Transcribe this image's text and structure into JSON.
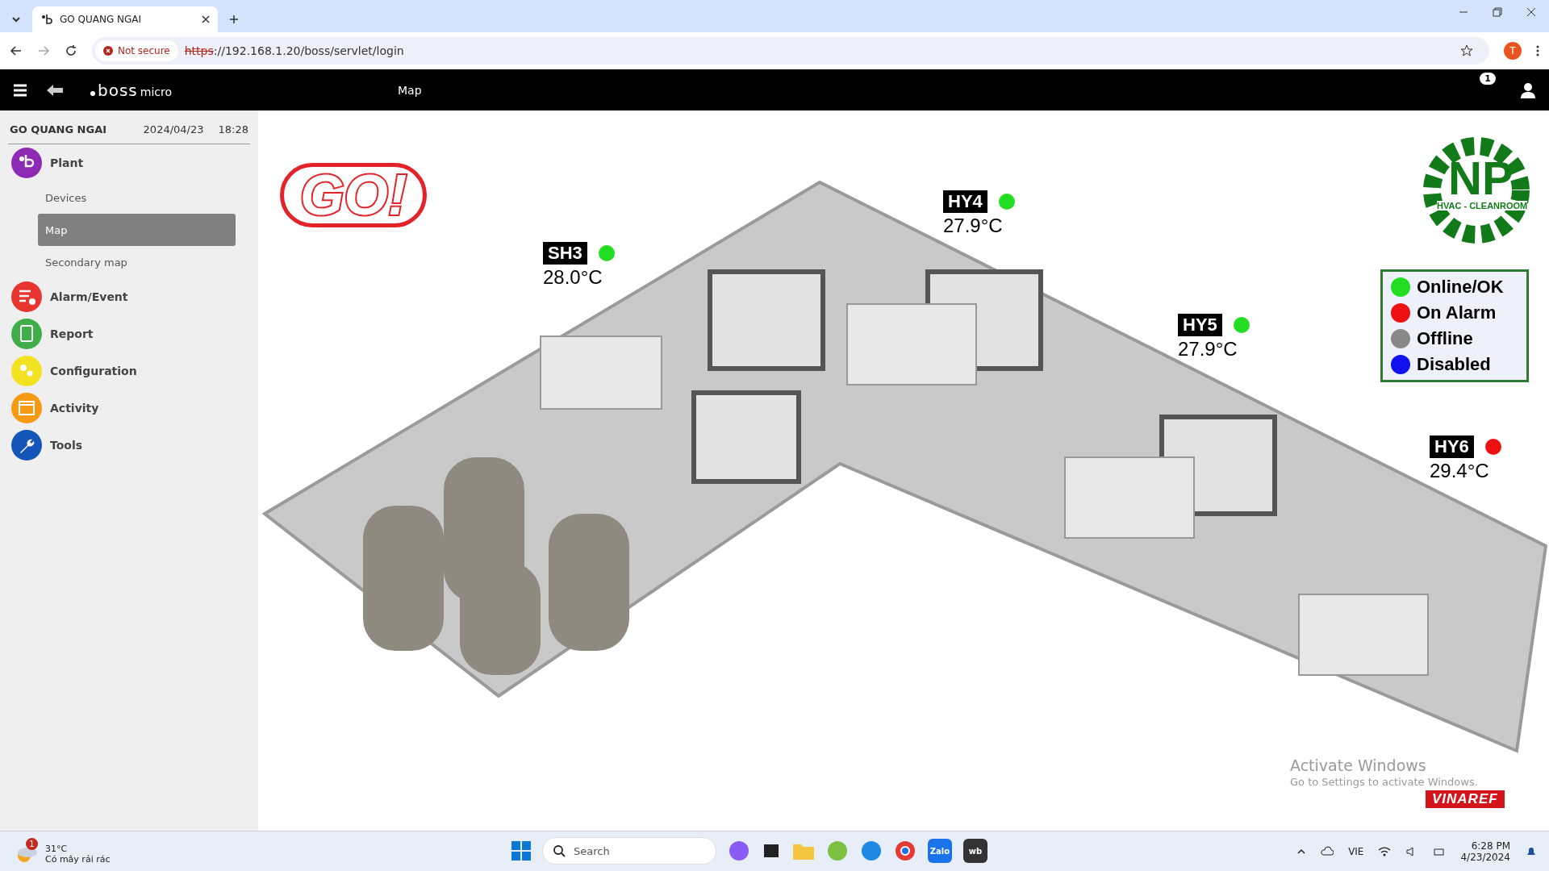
{
  "browser": {
    "tab_title": "GO QUANG NGAI",
    "security": "Not secure",
    "url_scheme": "https",
    "url_rest": "://192.168.1.20/boss/servlet/login",
    "profile": "T"
  },
  "header": {
    "brand": "boss",
    "brand_suffix": "micro",
    "title": "Map",
    "notifications": "1"
  },
  "sidebar": {
    "site": "GO QUANG NGAI",
    "date": "2024/04/23",
    "time": "18:28",
    "sections": [
      {
        "label": "Plant",
        "kind": "plant",
        "color": "#8e2bb5",
        "children": [
          {
            "label": "Devices",
            "selected": false
          },
          {
            "label": "Map",
            "selected": true
          },
          {
            "label": "Secondary map",
            "selected": false
          }
        ]
      },
      {
        "label": "Alarm/Event",
        "kind": "alarm",
        "color": "#e8352f"
      },
      {
        "label": "Report",
        "kind": "report",
        "color": "#3fae49"
      },
      {
        "label": "Configuration",
        "kind": "config",
        "color": "#f2e222"
      },
      {
        "label": "Activity",
        "kind": "activity",
        "color": "#f59a12"
      },
      {
        "label": "Tools",
        "kind": "tools",
        "color": "#1554b8"
      }
    ]
  },
  "map": {
    "go_logo": "GO!",
    "np_logo": {
      "letters": "NP",
      "caption": "HVAC - CLEANROOM"
    },
    "vinaref_logo": "VINAREF",
    "devices": [
      {
        "name": "SH3",
        "temperature": "28.0°C",
        "color": "#22dd22"
      },
      {
        "name": "HY4",
        "temperature": "27.9°C",
        "color": "#22dd22"
      },
      {
        "name": "HY5",
        "temperature": "27.9°C",
        "color": "#22dd22"
      },
      {
        "name": "HY6",
        "temperature": "29.4°C",
        "color": "#ee1111"
      }
    ],
    "legend": [
      {
        "label": "Online/OK",
        "color": "#22dd22"
      },
      {
        "label": "On Alarm",
        "color": "#ee1111"
      },
      {
        "label": "Offline",
        "color": "#888888"
      },
      {
        "label": "Disabled",
        "color": "#1111ee"
      }
    ]
  },
  "os_notice": {
    "title": "Activate Windows",
    "subtitle": "Go to Settings to activate Windows."
  },
  "taskbar": {
    "weather_temp": "31°C",
    "weather_text": "Có mây rải rác",
    "weather_badge": "1",
    "search_placeholder": "Search",
    "apps": [
      "Zalo",
      "wb"
    ],
    "language": "VIE",
    "time": "6:28 PM",
    "date": "4/23/2024"
  }
}
